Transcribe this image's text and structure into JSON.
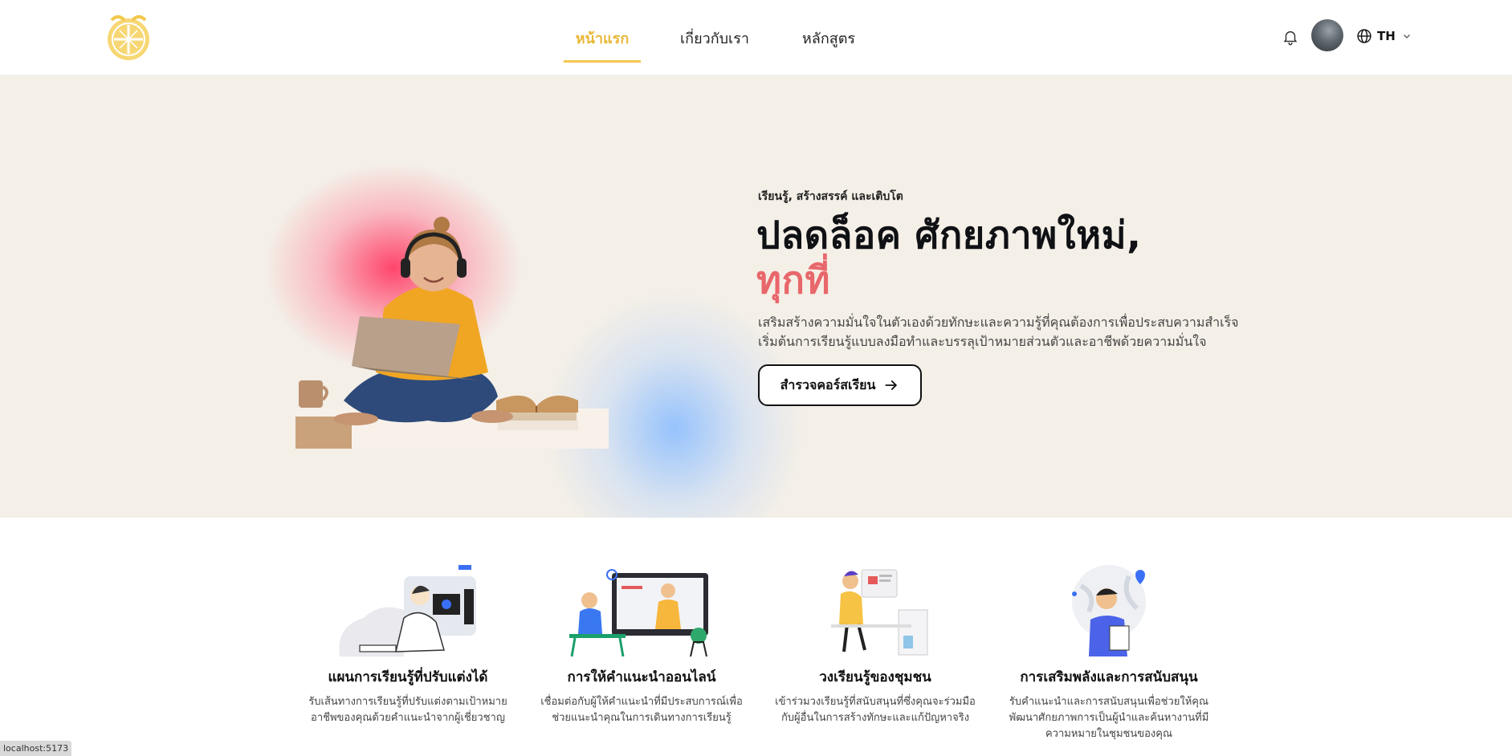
{
  "header": {
    "nav": [
      {
        "label": "หน้าแรก",
        "active": true
      },
      {
        "label": "เกี่ยวกับเรา",
        "active": false
      },
      {
        "label": "หลักสูตร",
        "active": false
      }
    ],
    "icons": {
      "logo": "university-emblem-logo",
      "bell": "bell-icon",
      "globe": "globe-icon",
      "chevron": "chevron-down-icon"
    },
    "language_code": "TH"
  },
  "hero": {
    "tagline": "เรียนรู้, สร้างสรรค์ และเติบโต",
    "headline_line1": "ปลดล็อค ศักยภาพใหม่,",
    "headline_line2": "ทุกที่",
    "description_line1": "เสริมสร้างความมั่นใจในตัวเองด้วยทักษะและความรู้ที่คุณต้องการเพื่อประสบความสำเร็จ",
    "description_line2": "เริ่มต้นการเรียนรู้แบบลงมือทำและบรรลุเป้าหมายส่วนตัวและอาชีพด้วยความมั่นใจ",
    "cta_label": "สำรวจคอร์สเรียน"
  },
  "features": [
    {
      "title": "แผนการเรียนรู้ที่ปรับแต่งได้",
      "desc_line1": "รับเส้นทางการเรียนรู้ที่ปรับแต่งตามเป้าหมาย",
      "desc_line2": "อาชีพของคุณด้วยคำแนะนำจากผู้เชี่ยวชาญ",
      "desc_line3": ""
    },
    {
      "title": "การให้คำแนะนำออนไลน์",
      "desc_line1": "เชื่อมต่อกับผู้ให้คำแนะนำที่มีประสบการณ์เพื่อ",
      "desc_line2": "ช่วยแนะนำคุณในการเดินทางการเรียนรู้",
      "desc_line3": ""
    },
    {
      "title": "วงเรียนรู้ของชุมชน",
      "desc_line1": "เข้าร่วมวงเรียนรู้ที่สนับสนุนที่ซึ่งคุณจะร่วมมือ",
      "desc_line2": "กับผู้อื่นในการสร้างทักษะและแก้ปัญหาจริง",
      "desc_line3": ""
    },
    {
      "title": "การเสริมพลังและการสนับสนุน",
      "desc_line1": "รับคำแนะนำและการสนับสนุนเพื่อช่วยให้คุณ",
      "desc_line2": "พัฒนาศักยภาพการเป็นผู้นำและค้นหางานที่มี",
      "desc_line3": "ความหมายในชุมชนของคุณ"
    }
  ],
  "status_bar": {
    "url_text": "localhost:5173"
  },
  "colors": {
    "accent_yellow": "#f2c94c",
    "accent_red": "#e8676b",
    "hero_bg": "#f4efe7"
  }
}
